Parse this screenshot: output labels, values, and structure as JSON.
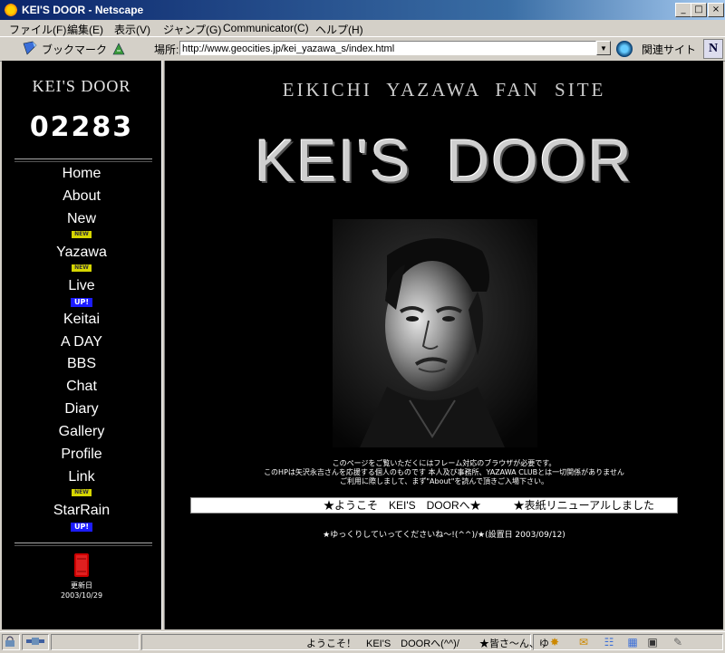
{
  "window": {
    "title": "KEI'S DOOR - Netscape",
    "minimize": "_",
    "maximize": "□",
    "close": "×"
  },
  "menu": [
    "ファイル(F)",
    "編集(E)",
    "表示(V)",
    "ジャンプ(G)",
    "Communicator(C)",
    "ヘルプ(H)"
  ],
  "toolbar": {
    "bookmarks_label": "ブックマーク",
    "location_label": "場所:",
    "url": "http://www.geocities.jp/kei_yazawa_s/index.html",
    "related_label": "関連サイト",
    "logo": "N"
  },
  "sidebar": {
    "site_title": "KEI'S DOOR",
    "counter": "02283",
    "nav": [
      {
        "label": "Home"
      },
      {
        "label": "About"
      },
      {
        "label": "New",
        "badge": "NEW"
      },
      {
        "label": "Yazawa",
        "badge": "NEW"
      },
      {
        "label": "Live",
        "badge": "UP!"
      },
      {
        "label": "Keitai"
      },
      {
        "label": "A DAY"
      },
      {
        "label": "BBS"
      },
      {
        "label": "Chat"
      },
      {
        "label": "Diary"
      },
      {
        "label": "Gallery"
      },
      {
        "label": "Profile"
      },
      {
        "label": "Link",
        "badge": "NEW"
      },
      {
        "label": "StarRain",
        "badge": "UP!"
      }
    ],
    "update_label": "更新日",
    "update_date": "2003/10/29"
  },
  "main": {
    "subtitle": "EIKICHI YAZAWA FAN SITE",
    "title": "KEI'S DOOR",
    "notice_lines": [
      "このページをご覧いただくにはフレーム対応のブラウザが必要です。",
      "このHPは矢沢永吉さんを応援する個人のものです 本人及び事務所、YAZAWA CLUBとは一切関係がありません",
      "ご利用に際しまして、まず\"About\"を読んで頂きご入場下さい。"
    ],
    "marquee": "★ようこそ　KEI'S　DOORへ★　　　★表紙リニューアルしました",
    "footer": "★ゆっくりしていってくださいね〜!(^^)/★(設置日 2003/09/12)"
  },
  "status": {
    "text": "ようこそ！　KEI'S　DOORへ(^^)/　　★皆さ〜ん、ゆ"
  },
  "colors": {
    "titlebar_start": "#0a246a",
    "page_background": "#000000",
    "chrome": "#d4d0c8",
    "badge_new": "#d6d600",
    "badge_up": "#1c1cff",
    "update_icon": "#cc0000"
  }
}
